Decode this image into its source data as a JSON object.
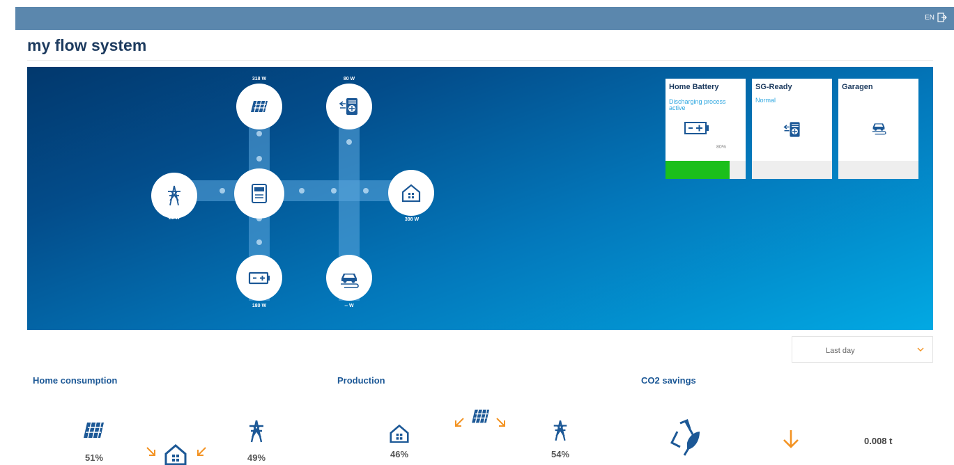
{
  "header": {
    "language": "EN"
  },
  "page": {
    "title": "my flow system"
  },
  "flow": {
    "solar_watt": "318 W",
    "heatpump_watt": "80 W",
    "grid_watt": "20 W",
    "house_watt": "398 W",
    "battery_watt": "180 W",
    "car_watt": "-- W"
  },
  "cards": [
    {
      "title": "Home Battery",
      "status": "Discharging process active",
      "percent": "80%",
      "fill": 0.8,
      "icon": "battery-icon"
    },
    {
      "title": "SG-Ready",
      "status": "Normal",
      "icon": "heatpump-icon"
    },
    {
      "title": "Garagen",
      "status": "",
      "icon": "ev-car-icon"
    }
  ],
  "filter": {
    "selected": "Last day"
  },
  "sections": {
    "home_consumption": {
      "title": "Home consumption",
      "solar_pct": "51%",
      "grid_pct": "49%"
    },
    "production": {
      "title": "Production",
      "house_pct": "46%",
      "grid_pct": "54%"
    },
    "co2": {
      "title": "CO2 savings",
      "value": "0.008 t"
    }
  },
  "colors": {
    "accent": "#1c5896",
    "arrow": "#f39323",
    "battery_fill": "#1bbf1b",
    "topbar": "#5b87ad"
  }
}
